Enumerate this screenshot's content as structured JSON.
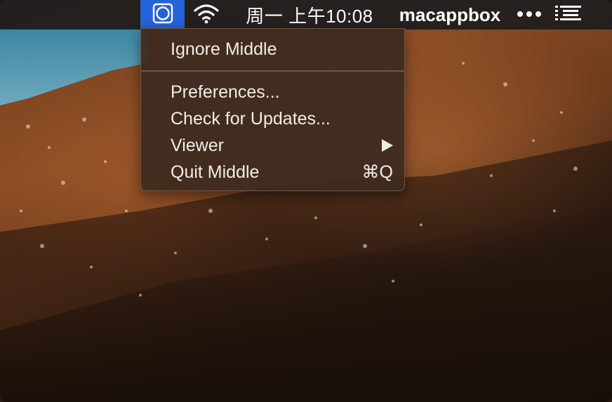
{
  "menubar": {
    "app_icon": "middle-app-icon",
    "wifi_icon": "wifi-icon",
    "clock": "周一 上午10:08",
    "username": "macappbox",
    "more_icon": "ellipsis-icon",
    "list_icon": "list-icon",
    "active_color": "#2463d9"
  },
  "menu": {
    "items": [
      {
        "label": "Ignore Middle",
        "shortcut": ""
      },
      {
        "label": "Preferences...",
        "shortcut": ""
      },
      {
        "label": "Check for Updates...",
        "shortcut": ""
      },
      {
        "label": "Viewer",
        "shortcut": "",
        "submenu": true
      },
      {
        "label": "Quit Middle",
        "shortcut": "⌘Q"
      }
    ]
  }
}
